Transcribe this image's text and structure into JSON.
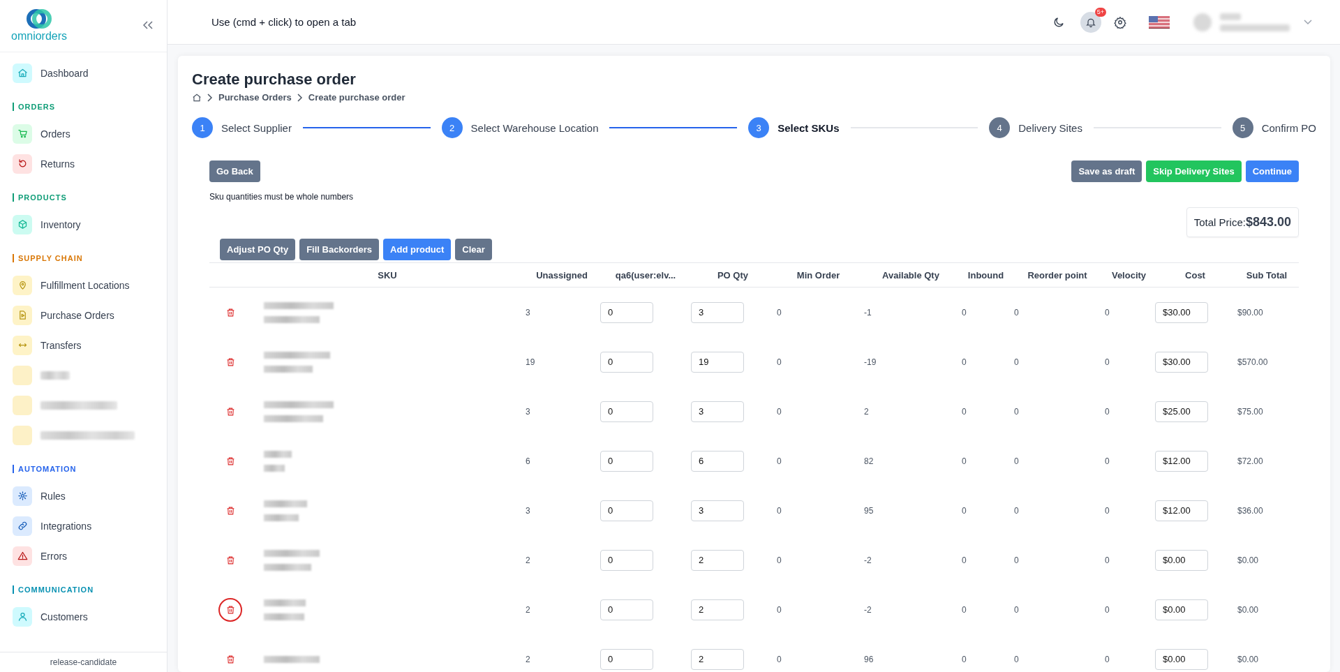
{
  "sidebar": {
    "logo_text": "omniorders",
    "top_items": [
      {
        "kind": "link",
        "label": "Dashboard",
        "color": "#cffafe"
      }
    ],
    "sections": [
      {
        "title": "ORDERS",
        "color": "#0f9d77",
        "items": [
          {
            "kind": "link",
            "label": "Orders",
            "color": "#dcfce7"
          },
          {
            "kind": "link",
            "label": "Returns",
            "color": "#fee2e2"
          }
        ]
      },
      {
        "title": "PRODUCTS",
        "color": "#0f9d77",
        "items": [
          {
            "kind": "link",
            "label": "Inventory",
            "color": "#ccfbf1"
          }
        ]
      },
      {
        "title": "SUPPLY CHAIN",
        "color": "#d97706",
        "items": [
          {
            "kind": "link",
            "label": "Fulfillment Locations",
            "color": "#fef3c7"
          },
          {
            "kind": "link",
            "label": "Purchase Orders",
            "color": "#fef3c7"
          },
          {
            "kind": "link",
            "label": "Transfers",
            "color": "#fef3c7"
          },
          {
            "kind": "redacted",
            "color": "#fdf1c7"
          },
          {
            "kind": "redacted",
            "color": "#fdf1c7"
          },
          {
            "kind": "redacted",
            "color": "#fdf1c7"
          }
        ]
      },
      {
        "title": "AUTOMATION",
        "color": "#2563eb",
        "items": [
          {
            "kind": "link",
            "label": "Rules",
            "color": "#dbeafe"
          },
          {
            "kind": "link",
            "label": "Integrations",
            "color": "#dbeafe"
          },
          {
            "kind": "link",
            "label": "Errors",
            "color": "#fee2e2"
          }
        ]
      },
      {
        "title": "COMMUNICATION",
        "color": "#0891b2",
        "items": [
          {
            "kind": "link",
            "label": "Customers",
            "color": "#cffafe"
          }
        ]
      }
    ],
    "footer": "release-candidate"
  },
  "header": {
    "hint": "Use (cmd + click) to open a tab",
    "notification_badge": "5+"
  },
  "page": {
    "title": "Create purchase order",
    "breadcrumb": [
      "Purchase Orders",
      "Create purchase order"
    ],
    "steps": [
      {
        "number": "1",
        "label": "Select Supplier",
        "selected": false
      },
      {
        "number": "2",
        "label": "Select Warehouse Location",
        "selected": false
      },
      {
        "number": "3",
        "label": "Select SKUs",
        "selected": true
      },
      {
        "number": "4",
        "label": "Delivery Sites",
        "selected": false
      },
      {
        "number": "5",
        "label": "Confirm PO",
        "selected": false
      }
    ],
    "back_button": "Go Back",
    "actions": [
      {
        "label": "Save as draft",
        "kind": "secondary"
      },
      {
        "label": "Skip Delivery Sites",
        "kind": "success"
      },
      {
        "label": "Continue",
        "kind": "primary"
      }
    ],
    "note": "Sku quantities must be whole numbers",
    "total_label": "Total Price:",
    "total_value": "$843.00",
    "table_buttons": [
      {
        "label": "Adjust PO Qty",
        "kind": "secondary"
      },
      {
        "label": "Fill Backorders",
        "kind": "secondary"
      },
      {
        "label": "Add product",
        "kind": "primary"
      },
      {
        "label": "Clear",
        "kind": "secondary"
      }
    ]
  },
  "table": {
    "columns": [
      "SKU",
      "Unassigned",
      "qa6(user:elv...",
      "PO Qty",
      "Min Order",
      "Available Qty",
      "Inbound",
      "Reorder point",
      "Velocity",
      "Cost",
      "Sub Total"
    ],
    "rows": [
      {
        "unassigned": "3",
        "qa6": "0",
        "po_qty": "3",
        "min_order": "0",
        "available": "-1",
        "inbound": "0",
        "reorder": "0",
        "velocity": "0",
        "cost": "$30.00",
        "subtotal": "$90.00",
        "focused": false
      },
      {
        "unassigned": "19",
        "qa6": "0",
        "po_qty": "19",
        "min_order": "0",
        "available": "-19",
        "inbound": "0",
        "reorder": "0",
        "velocity": "0",
        "cost": "$30.00",
        "subtotal": "$570.00",
        "focused": false
      },
      {
        "unassigned": "3",
        "qa6": "0",
        "po_qty": "3",
        "min_order": "0",
        "available": "2",
        "inbound": "0",
        "reorder": "0",
        "velocity": "0",
        "cost": "$25.00",
        "subtotal": "$75.00",
        "focused": false
      },
      {
        "unassigned": "6",
        "qa6": "0",
        "po_qty": "6",
        "min_order": "0",
        "available": "82",
        "inbound": "0",
        "reorder": "0",
        "velocity": "0",
        "cost": "$12.00",
        "subtotal": "$72.00",
        "focused": false
      },
      {
        "unassigned": "3",
        "qa6": "0",
        "po_qty": "3",
        "min_order": "0",
        "available": "95",
        "inbound": "0",
        "reorder": "0",
        "velocity": "0",
        "cost": "$12.00",
        "subtotal": "$36.00",
        "focused": false
      },
      {
        "unassigned": "2",
        "qa6": "0",
        "po_qty": "2",
        "min_order": "0",
        "available": "-2",
        "inbound": "0",
        "reorder": "0",
        "velocity": "0",
        "cost": "$0.00",
        "subtotal": "$0.00",
        "focused": false
      },
      {
        "unassigned": "2",
        "qa6": "0",
        "po_qty": "2",
        "min_order": "0",
        "available": "-2",
        "inbound": "0",
        "reorder": "0",
        "velocity": "0",
        "cost": "$0.00",
        "subtotal": "$0.00",
        "focused": true
      },
      {
        "unassigned": "2",
        "qa6": "0",
        "po_qty": "2",
        "min_order": "0",
        "available": "96",
        "inbound": "0",
        "reorder": "0",
        "velocity": "0",
        "cost": "$0.00",
        "subtotal": "$0.00",
        "focused": false
      }
    ]
  }
}
